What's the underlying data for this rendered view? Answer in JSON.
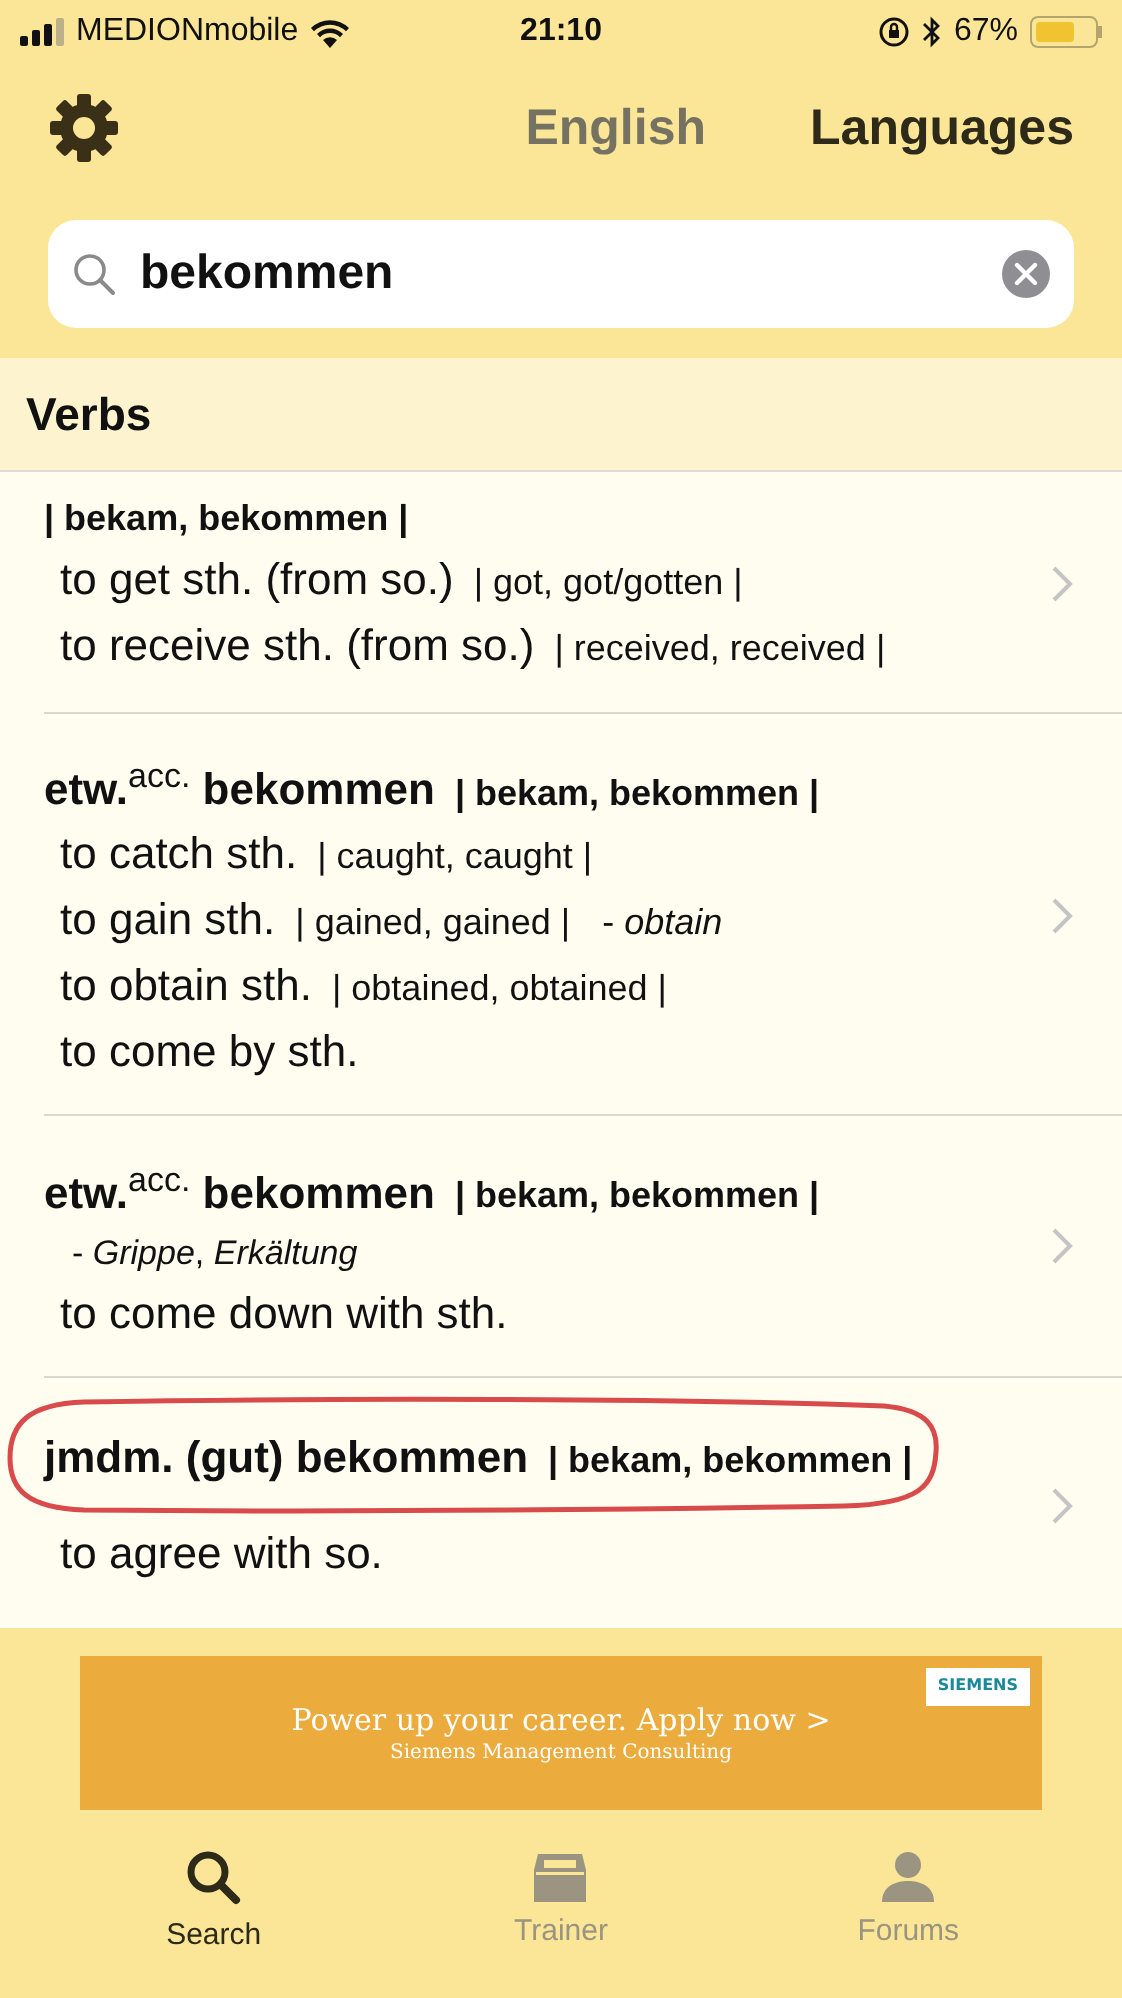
{
  "status_bar": {
    "carrier": "MEDIONmobile",
    "time": "21:10",
    "battery": "67%"
  },
  "header": {
    "language": "English",
    "languages_button": "Languages"
  },
  "search": {
    "value": "bekommen"
  },
  "section": {
    "title": "Verbs"
  },
  "entries": [
    {
      "forms": "| bekam, bekommen |",
      "lines": [
        {
          "text": "to get sth. (from so.)",
          "forms": "| got, got/gotten |"
        },
        {
          "text": "to receive sth. (from so.)",
          "forms": "| received, received |"
        }
      ]
    },
    {
      "headword": "etw.$^{acc.}$ bekommen",
      "forms": "| bekam, bekommen |",
      "lines": [
        {
          "text": "to catch sth.",
          "forms": "| caught, caught |"
        },
        {
          "text": "to gain sth.",
          "forms": "| gained, gained |",
          "note": "- *obtain*"
        },
        {
          "text": "to obtain sth.",
          "forms": "| obtained, obtained |"
        },
        {
          "text": "to come by sth."
        }
      ]
    },
    {
      "headword": "etw.$^{acc.}$ bekommen",
      "forms": "| bekam, bekommen |",
      "context": "- *Grippe*, *Erkältung*",
      "lines": [
        {
          "text": "to come down with sth."
        }
      ]
    },
    {
      "headword": "jmdm. (gut) bekommen",
      "forms": "| bekam, bekommen |",
      "circled": true,
      "lines": [
        {
          "text": "to agree with so."
        }
      ]
    }
  ],
  "ad": {
    "title": "Power up your career. Apply now >",
    "subtitle": "Siemens Management Consulting",
    "logo": "SIEMENS"
  },
  "tabs": [
    {
      "label": "Search",
      "selected": true
    },
    {
      "label": "Trainer",
      "selected": false
    },
    {
      "label": "Forums",
      "selected": false
    }
  ]
}
